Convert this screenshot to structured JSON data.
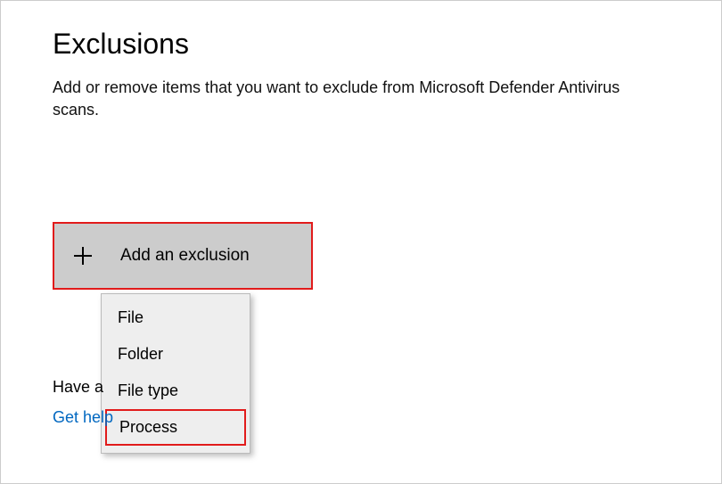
{
  "header": {
    "title": "Exclusions",
    "description": "Add or remove items that you want to exclude from Microsoft Defender Antivirus scans."
  },
  "button": {
    "label": "Add an exclusion"
  },
  "dropdown": {
    "items": [
      {
        "label": "File"
      },
      {
        "label": "Folder"
      },
      {
        "label": "File type"
      },
      {
        "label": "Process"
      }
    ]
  },
  "footer": {
    "question_partial": "Have a",
    "help_partial": "Get help"
  }
}
